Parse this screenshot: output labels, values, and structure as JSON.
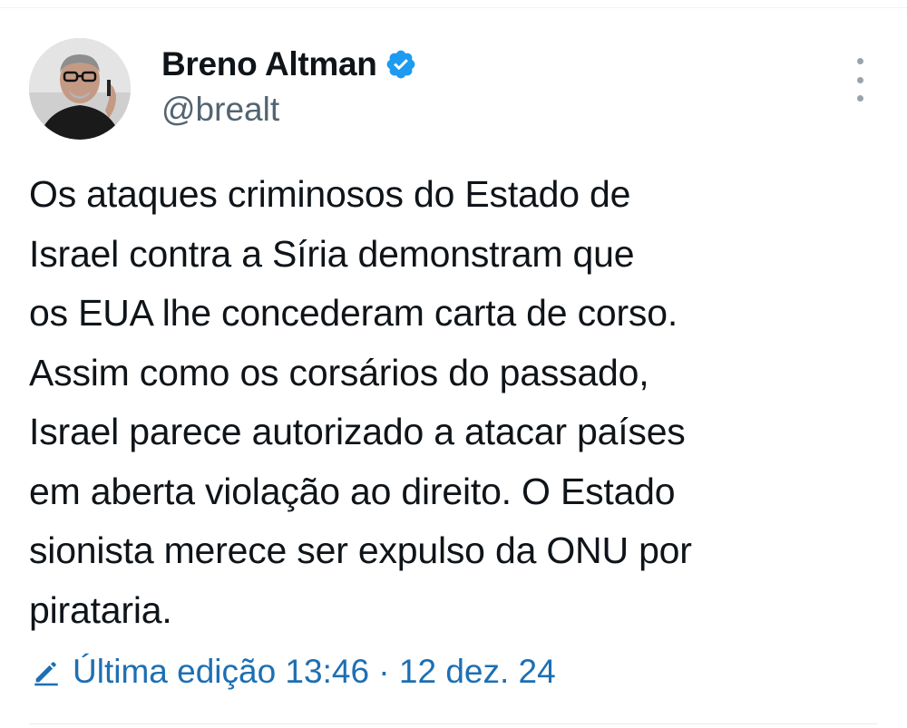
{
  "author": {
    "display_name": "Breno Altman",
    "handle": "@brealt",
    "verified": true
  },
  "tweet": {
    "lines": [
      "Os ataques criminosos do Estado de",
      "Israel contra a Síria demonstram que",
      "os EUA lhe concederam carta de corso.",
      "Assim como os corsários do passado,",
      "Israel parece autorizado a atacar países",
      "em aberta violação ao direito. O Estado",
      "sionista merece ser expulso da ONU por",
      "pirataria."
    ]
  },
  "meta": {
    "edit_label": "Última edição 13:46 · 12 dez. 24"
  },
  "icons": {
    "verified": "verified-badge-icon",
    "more": "more-options-icon",
    "edit": "pencil-icon"
  },
  "colors": {
    "accent": "#1d9bf0",
    "edit_link": "#1d6fb3",
    "muted": "#536471",
    "text": "#0f1419"
  }
}
